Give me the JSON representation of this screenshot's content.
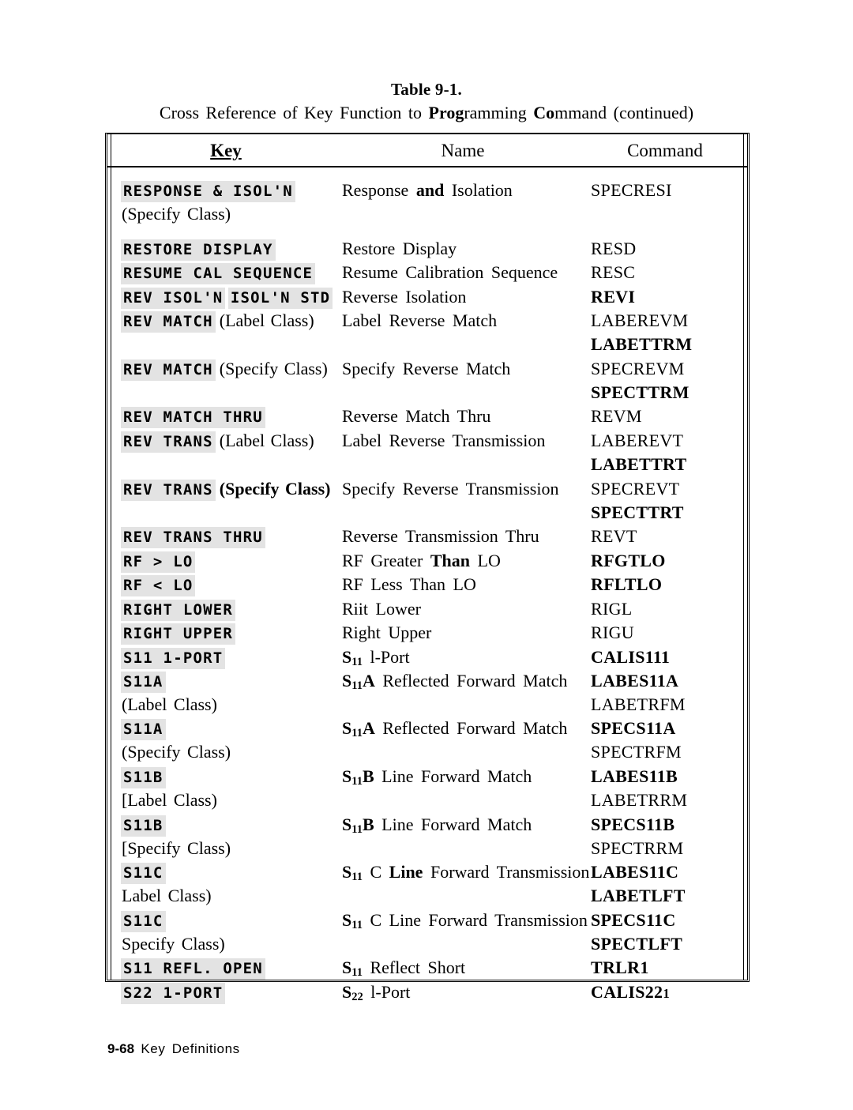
{
  "title": {
    "table_number": "Table 9-1.",
    "caption_pre": "Cross Reference of Key Function to ",
    "caption_b1": "Prog",
    "caption_mid1": "ramming ",
    "caption_b2": "Co",
    "caption_mid2": "mmand ",
    "caption_tail": "(continued)"
  },
  "table": {
    "headers": {
      "key": "Key",
      "name": "Name",
      "command": "Command"
    },
    "rows": [
      {
        "key_caps": [
          "RESPONSE & ISOL'N"
        ],
        "key_tail": "",
        "key_sub": "(Specify Class)",
        "name": "Response and Isolation",
        "name_bold_word": "and",
        "command": "SPECRESI",
        "command_bold": false
      },
      {
        "key_caps": [
          "RESTORE DISPLAY"
        ],
        "key_tail": "",
        "key_sub": "",
        "name": "Restore Display",
        "command": "RESD",
        "command_bold": false
      },
      {
        "key_caps": [
          "RESUME CAL SEQUENCE"
        ],
        "key_tail": "",
        "key_sub": "",
        "name": "Resume Calibration Sequence",
        "command": "RESC",
        "command_bold": false
      },
      {
        "key_caps": [
          "REV ISOL'N",
          "ISOL'N STD"
        ],
        "key_tail": "",
        "key_sub": "",
        "name": "Reverse Isolation",
        "command": "REVI",
        "command_bold": true
      },
      {
        "key_caps": [
          "REV MATCH"
        ],
        "key_tail": "(Label Class)",
        "key_tail_bold": false,
        "key_sub": "",
        "name": "Label Reverse Match",
        "command": "LABEREVM",
        "command_bold": false,
        "command2": "LABETTRM",
        "command2_bold": true
      },
      {
        "key_caps": [
          "REV MATCH"
        ],
        "key_tail": "(Specify Class)",
        "key_tail_bold": false,
        "key_sub": "",
        "name": "Specify Reverse Match",
        "command": "SPECREVM",
        "command_bold": false,
        "command2": "SPECTTRM",
        "command2_bold": true
      },
      {
        "key_caps": [
          "REV MATCH THRU"
        ],
        "key_tail": "",
        "key_sub": "",
        "name": "Reverse Match Thru",
        "command": "REVM",
        "command_bold": false
      },
      {
        "key_caps": [
          "REV TRANS"
        ],
        "key_tail": "(Label Class)",
        "key_tail_bold": false,
        "key_sub": "",
        "name": "Label Reverse Transmission",
        "command": "LABEREVT",
        "command_bold": false,
        "command2": "LABETTRT",
        "command2_bold": true
      },
      {
        "key_caps": [
          "REV TRANS"
        ],
        "key_tail": "(Specify Class)",
        "key_tail_bold": true,
        "key_sub": "",
        "name": "Specify Reverse Transmission",
        "command": "SPECREVT",
        "command_bold": false,
        "command2": "SPECTTRT",
        "command2_bold": true
      },
      {
        "key_caps": [
          "REV TRANS THRU"
        ],
        "key_tail": "",
        "key_sub": "",
        "name": "Reverse Transmission Thru",
        "command": "REVT",
        "command_bold": false
      },
      {
        "key_caps": [
          "RF > LO"
        ],
        "key_tail": "",
        "key_sub": "",
        "name": "RF Greater Than LO",
        "name_bold_word": "Than",
        "command": "RFGTLO",
        "command_bold": true
      },
      {
        "key_caps": [
          "RF < LO"
        ],
        "key_tail": "",
        "key_sub": "",
        "name": "RF Less Than LO",
        "command": "RFLTLO",
        "command_bold": true
      },
      {
        "key_caps": [
          "RIGHT LOWER"
        ],
        "key_tail": "",
        "key_sub": "",
        "name": "Riit Lower",
        "command": "RIGL",
        "command_bold": false
      },
      {
        "key_caps": [
          "RIGHT UPPER"
        ],
        "key_tail": "",
        "key_sub": "",
        "name": "Right Upper",
        "command": "RIGU",
        "command_bold": false
      },
      {
        "key_caps": [
          "S11 1-PORT"
        ],
        "key_tail": "",
        "key_sub": "",
        "name_sym": "S",
        "name_subscript": "11",
        "name_rest": " l-Port",
        "command": "CALIS111",
        "command_bold": true
      },
      {
        "key_caps": [
          "S11A"
        ],
        "key_tail": "",
        "key_sub": "(Label Class)",
        "name_sym": "S",
        "name_subscript": "11",
        "name_suffix": "A",
        "name_rest": " Reflected Forward Match",
        "command": "LABES11A",
        "command_bold": true,
        "command2": "LABETRFM",
        "command2_bold": false
      },
      {
        "key_caps": [
          "S11A"
        ],
        "key_tail": "",
        "key_sub": "(Specify Class)",
        "name_sym": "S",
        "name_subscript": "11",
        "name_suffix": "A",
        "name_rest": " Reflected Forward Match",
        "command": "SPECS11A",
        "command_bold": true,
        "command2": "SPECTRFM",
        "command2_bold": false
      },
      {
        "key_caps": [
          "S11B"
        ],
        "key_tail": "",
        "key_sub": "[Label Class)",
        "name_sym": "S",
        "name_subscript": "11",
        "name_suffix": "B",
        "name_rest": " Line Forward Match",
        "command": "LABES11B",
        "command_bold": true,
        "command2": "LABETRRM",
        "command2_bold": false
      },
      {
        "key_caps": [
          "S11B"
        ],
        "key_tail": "",
        "key_sub": "[Specify Class)",
        "name_sym": "S",
        "name_subscript": "11",
        "name_suffix": "B",
        "name_rest": " Line Forward Match",
        "command": "SPECS11B",
        "command_bold": true,
        "command2": "SPECTRRM",
        "command2_bold": false
      },
      {
        "key_caps": [
          "S11C"
        ],
        "key_tail": "",
        "key_sub": "Label Class)",
        "name_sym": "S",
        "name_subscript": "11",
        "name_rest": " C Line Forward Transmission",
        "name_bold_word": "Line",
        "command": "LABES11C",
        "command_bold": true,
        "command2": "LABETLFT",
        "command2_bold": true
      },
      {
        "key_caps": [
          "S11C"
        ],
        "key_tail": "",
        "key_sub": "Specify Class)",
        "name_sym": "S",
        "name_subscript": "11",
        "name_rest": " C Line Forward Transmission",
        "command": "SPECS11C",
        "command_bold": true,
        "command2": "SPECTLFT",
        "command2_bold": true
      },
      {
        "key_caps": [
          "S11 REFL. OPEN"
        ],
        "key_tail": "",
        "key_sub": "",
        "name_sym": "S",
        "name_subscript": "11",
        "name_rest": " Reflect Short",
        "command": "TRLR1",
        "command_bold": true
      },
      {
        "key_caps": [
          "S22 1-PORT"
        ],
        "key_tail": "",
        "key_sub": "",
        "name_sym": "S",
        "name_subscript": "22",
        "name_rest": " l-Port",
        "command": "CALIS22",
        "command_small_tail": "1",
        "command_bold": true
      }
    ]
  },
  "footer": {
    "page": "9-68",
    "section": "Key Definitions"
  }
}
